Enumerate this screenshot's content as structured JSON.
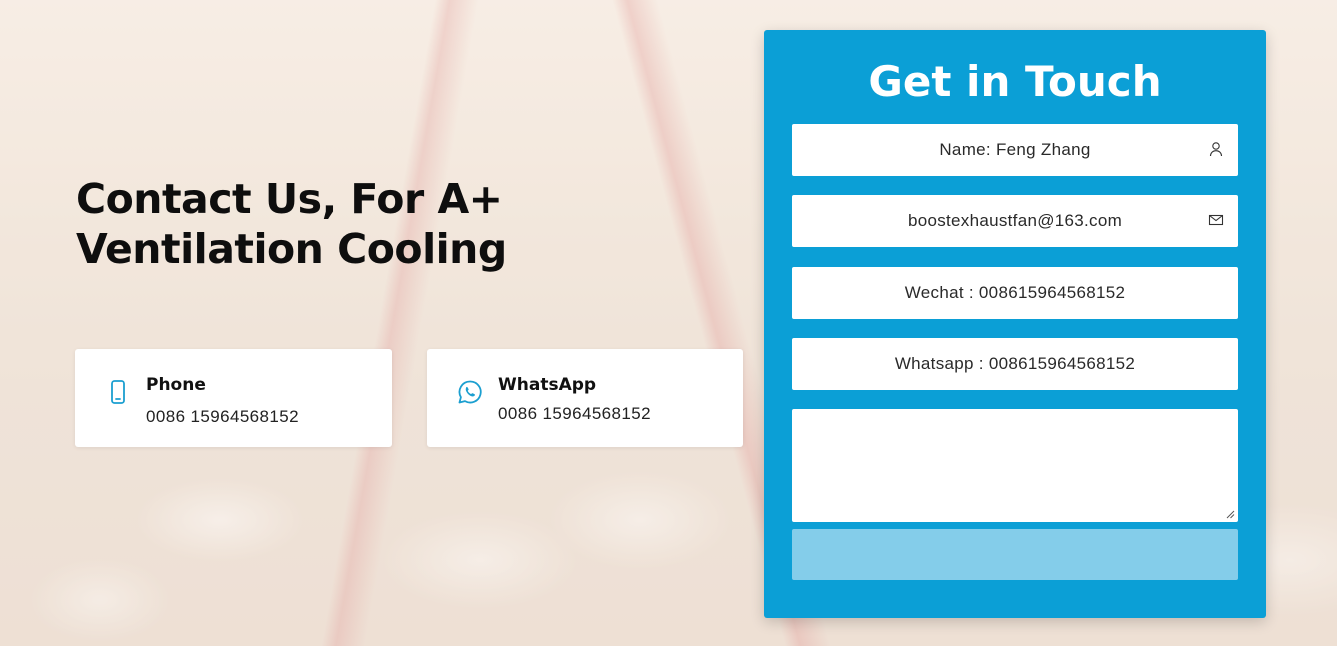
{
  "hero": {
    "headline": "Contact Us, For A+ Ventilation Cooling"
  },
  "contact_cards": [
    {
      "title": "Phone",
      "value": "0086 15964568152",
      "icon": "phone-icon"
    },
    {
      "title": "WhatsApp",
      "value": "0086 15964568152",
      "icon": "whatsapp-icon"
    }
  ],
  "form": {
    "title": "Get in Touch",
    "name_value": "Name: Feng Zhang",
    "email_value": "boostexhaustfan@163.com",
    "wechat_value": "Wechat : 008615964568152",
    "whatsapp_value": "Whatsapp : 008615964568152",
    "message_value": "",
    "submit_label": ""
  },
  "colors": {
    "accent": "#0b9fd6",
    "submit": "#84cdea",
    "icon_blue": "#1b9fd0"
  }
}
